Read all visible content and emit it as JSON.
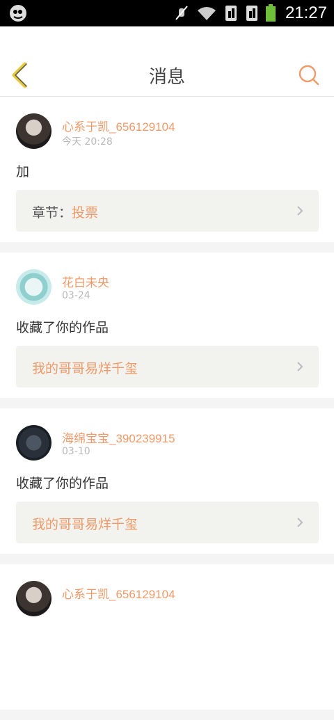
{
  "status_bar": {
    "time": "21:27",
    "icons": [
      "app-notification-icon",
      "mute-icon",
      "wifi-icon",
      "sim1-icon",
      "sim2-icon",
      "battery-icon"
    ]
  },
  "header": {
    "title": "消息",
    "back_icon": "chevron-left-icon",
    "search_icon": "search-icon"
  },
  "colors": {
    "accent": "#f09a6a",
    "back_arrow": "#e4c93a"
  },
  "messages": [
    {
      "username": "心系于凯_656129104",
      "time": "今天 20:28",
      "text": "加",
      "link_label": "章节：",
      "link_value": "投票"
    },
    {
      "username": "花白未央",
      "time": "03-24",
      "text": "收藏了你的作品",
      "link_title": "我的哥哥易烊千玺"
    },
    {
      "username": "海绵宝宝_390239915",
      "time": "03-10",
      "text": "收藏了你的作品",
      "link_title": "我的哥哥易烊千玺"
    },
    {
      "username": "心系于凯_656129104"
    }
  ]
}
